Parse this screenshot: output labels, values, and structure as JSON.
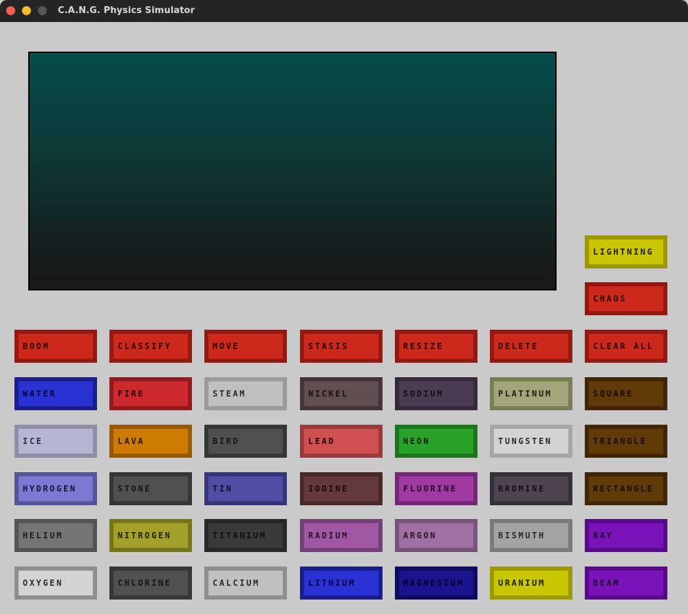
{
  "window": {
    "title": "C.A.N.G. Physics Simulator"
  },
  "buttons": [
    {
      "label": "LIGHTNING",
      "bg": "#c9c500",
      "bd": "#9c9900",
      "fg": "#1e1e00"
    },
    {
      "label": "CHAOS",
      "bg": "#cb2a1b",
      "bd": "#931a12",
      "fg": "#2a0500"
    },
    {
      "label": "BOOM",
      "bg": "#cb2a1b",
      "bd": "#931a12",
      "fg": "#2a0500"
    },
    {
      "label": "CLASSIFY",
      "bg": "#cb2a1b",
      "bd": "#931a12",
      "fg": "#2a0500"
    },
    {
      "label": "MOVE",
      "bg": "#cb2a1b",
      "bd": "#931a12",
      "fg": "#2a0500"
    },
    {
      "label": "STASIS",
      "bg": "#cb2a1b",
      "bd": "#931a12",
      "fg": "#2a0500"
    },
    {
      "label": "RESIZE",
      "bg": "#cb2a1b",
      "bd": "#931a12",
      "fg": "#2a0500"
    },
    {
      "label": "DELETE",
      "bg": "#cb2a1b",
      "bd": "#931a12",
      "fg": "#2a0500"
    },
    {
      "label": "CLEAR ALL",
      "bg": "#cb2a1b",
      "bd": "#931a12",
      "fg": "#2a0500"
    },
    {
      "label": "WATER",
      "bg": "#2b32d4",
      "bd": "#1c1e8a",
      "fg": "#05053a"
    },
    {
      "label": "FIRE",
      "bg": "#cd2a2e",
      "bd": "#931a1e",
      "fg": "#2a0505"
    },
    {
      "label": "STEAM",
      "bg": "#c0c0c0",
      "bd": "#9a9a9a",
      "fg": "#2a2a2a"
    },
    {
      "label": "NICKEL",
      "bg": "#614e4e",
      "bd": "#443636",
      "fg": "#1a1010"
    },
    {
      "label": "SODIUM",
      "bg": "#4c3c52",
      "bd": "#352a3a",
      "fg": "#150f18"
    },
    {
      "label": "PLATINUM",
      "bg": "#a3a47a",
      "bd": "#7a7c56",
      "fg": "#202010"
    },
    {
      "label": "SQUARE",
      "bg": "#603a09",
      "bd": "#412606",
      "fg": "#1a0d00"
    },
    {
      "label": "ICE",
      "bg": "#b7b7d3",
      "bd": "#8e8ea6",
      "fg": "#2a2a3a"
    },
    {
      "label": "LAVA",
      "bg": "#cd7a02",
      "bd": "#965a01",
      "fg": "#2e1a00"
    },
    {
      "label": "BIRD",
      "bg": "#505050",
      "bd": "#363636",
      "fg": "#151515"
    },
    {
      "label": "LEAD",
      "bg": "#cf5050",
      "bd": "#9a3a3a",
      "fg": "#2a0a0a"
    },
    {
      "label": "NEON",
      "bg": "#2aa32a",
      "bd": "#1c741c",
      "fg": "#052005"
    },
    {
      "label": "TUNGSTEN",
      "bg": "#d3d3d3",
      "bd": "#a6a6a6",
      "fg": "#2a2a2a"
    },
    {
      "label": "TRIANGLE",
      "bg": "#603a09",
      "bd": "#412606",
      "fg": "#1a0d00"
    },
    {
      "label": "HYDROGEN",
      "bg": "#7a7ad3",
      "bd": "#545499",
      "fg": "#15153a"
    },
    {
      "label": "STONE",
      "bg": "#505050",
      "bd": "#363636",
      "fg": "#151515"
    },
    {
      "label": "TIN",
      "bg": "#4e4ea3",
      "bd": "#353577",
      "fg": "#10102a"
    },
    {
      "label": "IODINE",
      "bg": "#663a3a",
      "bd": "#482828",
      "fg": "#1a0a0a"
    },
    {
      "label": "FLUORINE",
      "bg": "#a03aa3",
      "bd": "#742776",
      "fg": "#2a052a"
    },
    {
      "label": "BROMINE",
      "bg": "#4e4350",
      "bd": "#363038",
      "fg": "#141016"
    },
    {
      "label": "RECTANGLE",
      "bg": "#603a09",
      "bd": "#412606",
      "fg": "#1a0d00"
    },
    {
      "label": "HELIUM",
      "bg": "#757575",
      "bd": "#545454",
      "fg": "#1e1e1e"
    },
    {
      "label": "NITROGEN",
      "bg": "#a3a02a",
      "bd": "#76741c",
      "fg": "#202005"
    },
    {
      "label": "TITANIUM",
      "bg": "#3a3a3a",
      "bd": "#282828",
      "fg": "#101010"
    },
    {
      "label": "RADIUM",
      "bg": "#a05aa3",
      "bd": "#744176",
      "fg": "#2a102a"
    },
    {
      "label": "ARGON",
      "bg": "#a070a3",
      "bd": "#775279",
      "fg": "#2a152a"
    },
    {
      "label": "BISMUTH",
      "bg": "#a3a3a3",
      "bd": "#7a7a7a",
      "fg": "#2a2a2a"
    },
    {
      "label": "RAY",
      "bg": "#7a14b8",
      "bd": "#560c85",
      "fg": "#1e0530"
    },
    {
      "label": "OXYGEN",
      "bg": "#d3d3d3",
      "bd": "#8e8e8e",
      "fg": "#2a2a2a"
    },
    {
      "label": "CHLORINE",
      "bg": "#505050",
      "bd": "#363636",
      "fg": "#151515"
    },
    {
      "label": "CALCIUM",
      "bg": "#c0c0c0",
      "bd": "#8e8e8e",
      "fg": "#2a2a2a"
    },
    {
      "label": "LITHIUM",
      "bg": "#2b32d4",
      "bd": "#1c1e8a",
      "fg": "#05053a"
    },
    {
      "label": "MAGNESIUM",
      "bg": "#1a148f",
      "bd": "#0e0b60",
      "fg": "#03022a"
    },
    {
      "label": "URANIUM",
      "bg": "#c9c500",
      "bd": "#9c9900",
      "fg": "#1e1e00"
    },
    {
      "label": "BEAM",
      "bg": "#7a14b8",
      "bd": "#560c85",
      "fg": "#1e0530"
    }
  ]
}
